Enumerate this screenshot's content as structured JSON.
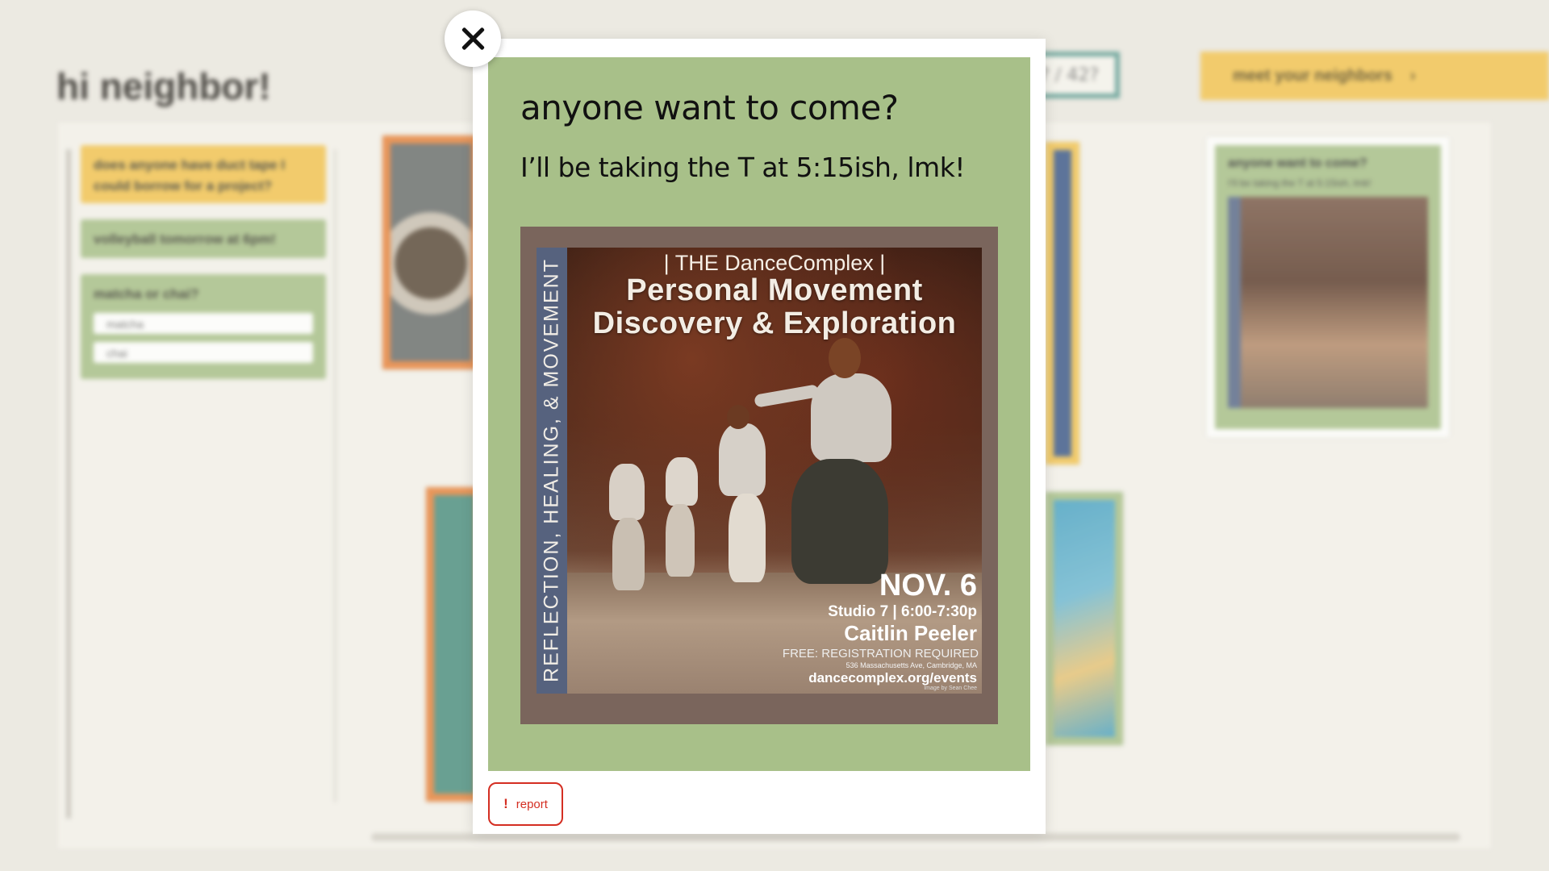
{
  "background": {
    "page_title": "hi neighbor!",
    "neighbors_button": "meet your neighbors",
    "neighbors_chevron": "›",
    "counter": "? / 42?",
    "notes": [
      {
        "text": "does anyone have duct tape I could borrow for a project?",
        "color": "yellow"
      },
      {
        "text": "volleyball tomorrow at 6pm!",
        "color": "green"
      }
    ],
    "poll": {
      "question": "matcha or chai?",
      "options": [
        "matcha",
        "chai"
      ]
    },
    "preview_card": {
      "title": "anyone want to come?",
      "body": "I’ll be taking the T at 5:15ish, lmk!"
    }
  },
  "modal": {
    "close_icon": "close-icon",
    "title": "anyone want to come?",
    "body": "I’ll be taking the T at 5:15ish, lmk!",
    "card_color": "#a8c089",
    "poster": {
      "brand": "| THE DanceComplex |",
      "headline_1": "Personal Movement",
      "headline_2": "Discovery & Exploration",
      "side_text": "REFLECTION, HEALING, & MOVEMENT",
      "date": "NOV. 6",
      "studio_time": "Studio 7 | 6:00-7:30p",
      "instructor": "Caitlin Peeler",
      "registration": "FREE: REGISTRATION REQUIRED",
      "address": "536 Massachusetts Ave, Cambridge, MA",
      "url": "dancecomplex.org/events",
      "credit": "Image by Sean Chee"
    },
    "report": {
      "icon": "!",
      "label": "report",
      "color": "#d42e22"
    }
  }
}
